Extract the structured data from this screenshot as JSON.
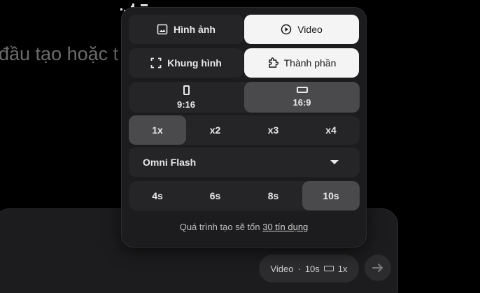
{
  "background": {
    "placeholder_text": "đầu tạo hoặc t"
  },
  "popup": {
    "type_tabs": [
      {
        "label": "Hình ảnh",
        "icon": "image-icon",
        "selected": false
      },
      {
        "label": "Video",
        "icon": "play-circle-icon",
        "selected": true
      }
    ],
    "mode_tabs": [
      {
        "label": "Khung hình",
        "icon": "frame-icon",
        "selected": false
      },
      {
        "label": "Thành phần",
        "icon": "component-icon",
        "selected": true
      }
    ],
    "aspect_ratios": [
      {
        "label": "9:16",
        "icon": "portrait-rect-icon",
        "selected": false
      },
      {
        "label": "16:9",
        "icon": "landscape-rect-icon",
        "selected": true
      }
    ],
    "count_options": [
      {
        "label": "1x",
        "selected": true
      },
      {
        "label": "x2",
        "selected": false
      },
      {
        "label": "x3",
        "selected": false
      },
      {
        "label": "x4",
        "selected": false
      }
    ],
    "model": {
      "selected": "Omni Flash",
      "icon": "caret-down-icon"
    },
    "duration_options": [
      {
        "label": "4s",
        "selected": false
      },
      {
        "label": "6s",
        "selected": false
      },
      {
        "label": "8s",
        "selected": false
      },
      {
        "label": "10s",
        "selected": true
      }
    ],
    "footer": {
      "text": "Quá trình tạo sẽ tốn",
      "link": "30 tín dụng"
    }
  },
  "composer": {
    "summary": {
      "type": "Video",
      "separator": "·",
      "duration": "10s",
      "count": "1x"
    },
    "send_icon": "arrow-right-icon"
  },
  "colors": {
    "background": "#000000",
    "panel": "#1c1c1e",
    "control": "#252527",
    "selected_dark": "#4a4a4c",
    "selected_light": "#f4f4f4"
  }
}
